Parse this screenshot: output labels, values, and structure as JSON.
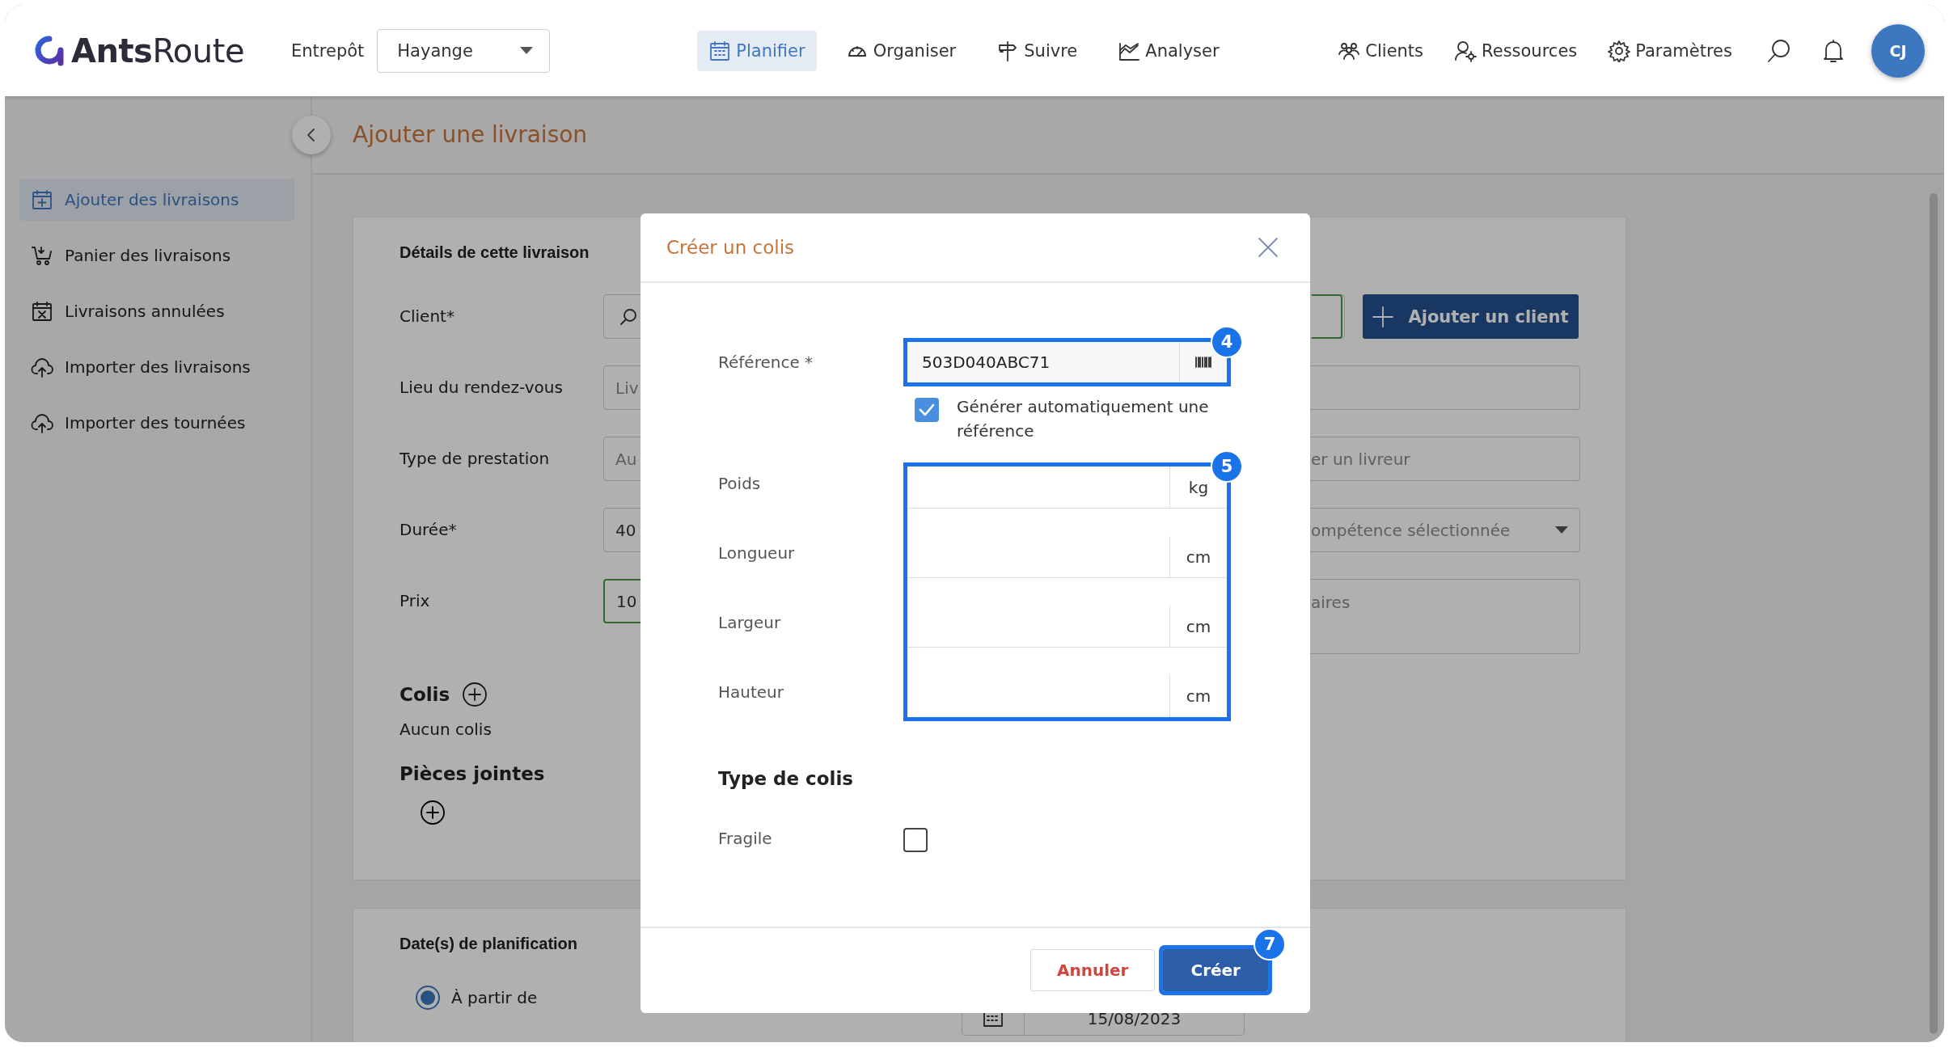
{
  "topbar": {
    "logo": {
      "bold": "Ants",
      "light": "Route"
    },
    "warehouse": {
      "label": "Entrepôt",
      "value": "Hayange"
    },
    "nav": [
      {
        "label": "Planifier",
        "selected": true
      },
      {
        "label": "Organiser",
        "selected": false
      },
      {
        "label": "Suivre",
        "selected": false
      },
      {
        "label": "Analyser",
        "selected": false
      }
    ],
    "right_nav": [
      {
        "label": "Clients"
      },
      {
        "label": "Ressources"
      },
      {
        "label": "Paramètres"
      }
    ],
    "avatar": "CJ"
  },
  "sidebar": {
    "items": [
      {
        "label": "Ajouter des livraisons",
        "selected": true
      },
      {
        "label": "Panier des livraisons",
        "selected": false
      },
      {
        "label": "Livraisons annulées",
        "selected": false
      },
      {
        "label": "Importer des livraisons",
        "selected": false
      },
      {
        "label": "Importer des tournées",
        "selected": false
      }
    ]
  },
  "page": {
    "title": "Ajouter une livraison"
  },
  "details": {
    "title": "Détails de cette livraison",
    "rows": [
      {
        "label": "Client*",
        "left": {
          "kind": "search",
          "focused": false
        },
        "right": {
          "kind": "button",
          "label": "Ajouter un client"
        }
      },
      {
        "label": "Lieu du rendez-vous",
        "left": {
          "kind": "input",
          "placeholder": "Liv",
          "focused": false
        },
        "right": {
          "kind": "input"
        }
      },
      {
        "label": "Type de prestation",
        "left": {
          "kind": "input",
          "placeholder": "Au",
          "focused": false
        },
        "right": {
          "kind": "input",
          "placeholder": "er un livreur"
        }
      },
      {
        "label": "Durée*",
        "left": {
          "kind": "input",
          "value": "40",
          "focused": false
        },
        "right": {
          "kind": "select",
          "placeholder": "ompétence sélectionnée"
        }
      },
      {
        "label": "Prix",
        "left": {
          "kind": "input",
          "value": "10",
          "focused": true
        },
        "right": {
          "kind": "textarea",
          "placeholder": "aires"
        }
      }
    ],
    "colis": {
      "title": "Colis",
      "empty": "Aucun colis"
    },
    "attachments": {
      "title": "Pièces jointes"
    }
  },
  "planning": {
    "title": "Date(s) de planification",
    "options": [
      {
        "label": "À partir de",
        "selected": true
      }
    ],
    "date": "15/08/2023"
  },
  "modal": {
    "title": "Créer un colis",
    "reference": {
      "label": "Référence *",
      "value": "503D040ABC71",
      "badge": "4"
    },
    "auto_reference": {
      "label": "Générer automatiquement une référence",
      "checked": true
    },
    "dimensions": {
      "badge": "5",
      "fields": [
        {
          "label": "Poids",
          "unit": "kg"
        },
        {
          "label": "Longueur",
          "unit": "cm"
        },
        {
          "label": "Largeur",
          "unit": "cm"
        },
        {
          "label": "Hauteur",
          "unit": "cm"
        }
      ]
    },
    "type_title": "Type de colis",
    "options": [
      {
        "label": "Fragile",
        "checked": false
      }
    ],
    "buttons": [
      {
        "label": "Annuler",
        "kind": "secondary"
      },
      {
        "label": "Créer",
        "kind": "primary",
        "badge": "7"
      }
    ]
  }
}
